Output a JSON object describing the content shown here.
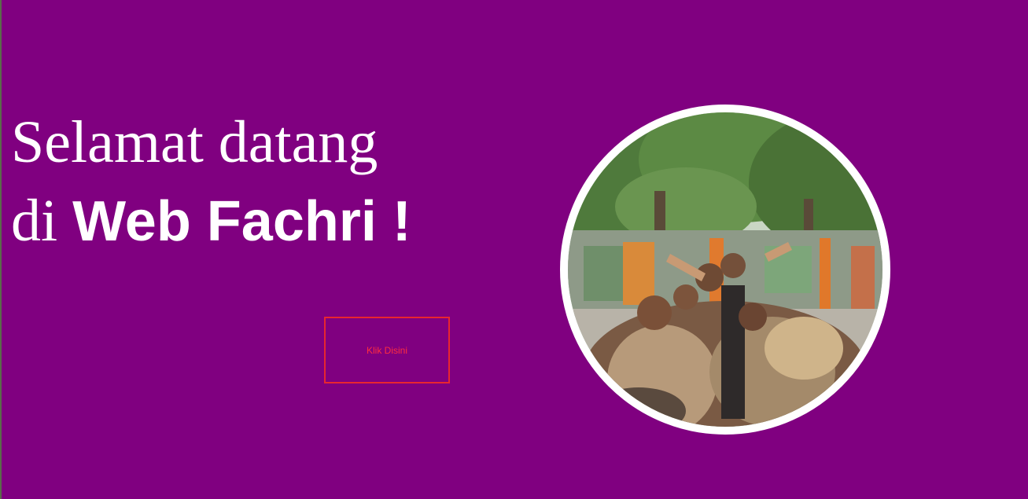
{
  "hero": {
    "greeting": "Selamat datang",
    "prefix": "di",
    "brand": "Web Fachri !",
    "button_label": "Klik Disini"
  },
  "photo": {
    "subject": "group-photo"
  },
  "colors": {
    "background": "#800080",
    "text": "#ffffff",
    "button_border": "#e8262f",
    "button_text": "#ff2d3f",
    "photo_border": "#ffffff"
  }
}
